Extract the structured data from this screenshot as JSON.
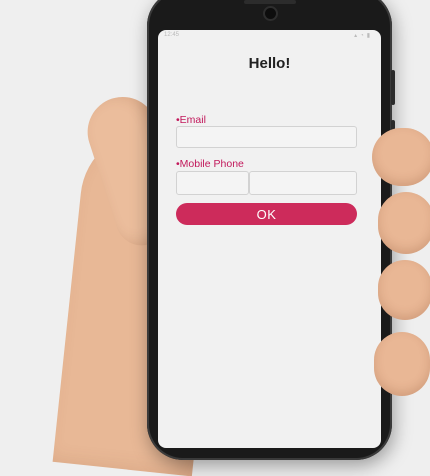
{
  "app": {
    "title": "Hello!"
  },
  "status_bar": {
    "time": "12:45",
    "icons": "signal-icon wifi-icon battery-icon"
  },
  "form": {
    "email_label": "•Email",
    "email_value": "",
    "email_placeholder": "",
    "phone_label": "•Mobile Phone",
    "phone_code_value": "",
    "phone_number_value": "",
    "ok_label": "OK"
  },
  "colors": {
    "accent": "#cd2b5b",
    "label": "#c2185b",
    "screen_bg": "#f1f1f1"
  }
}
